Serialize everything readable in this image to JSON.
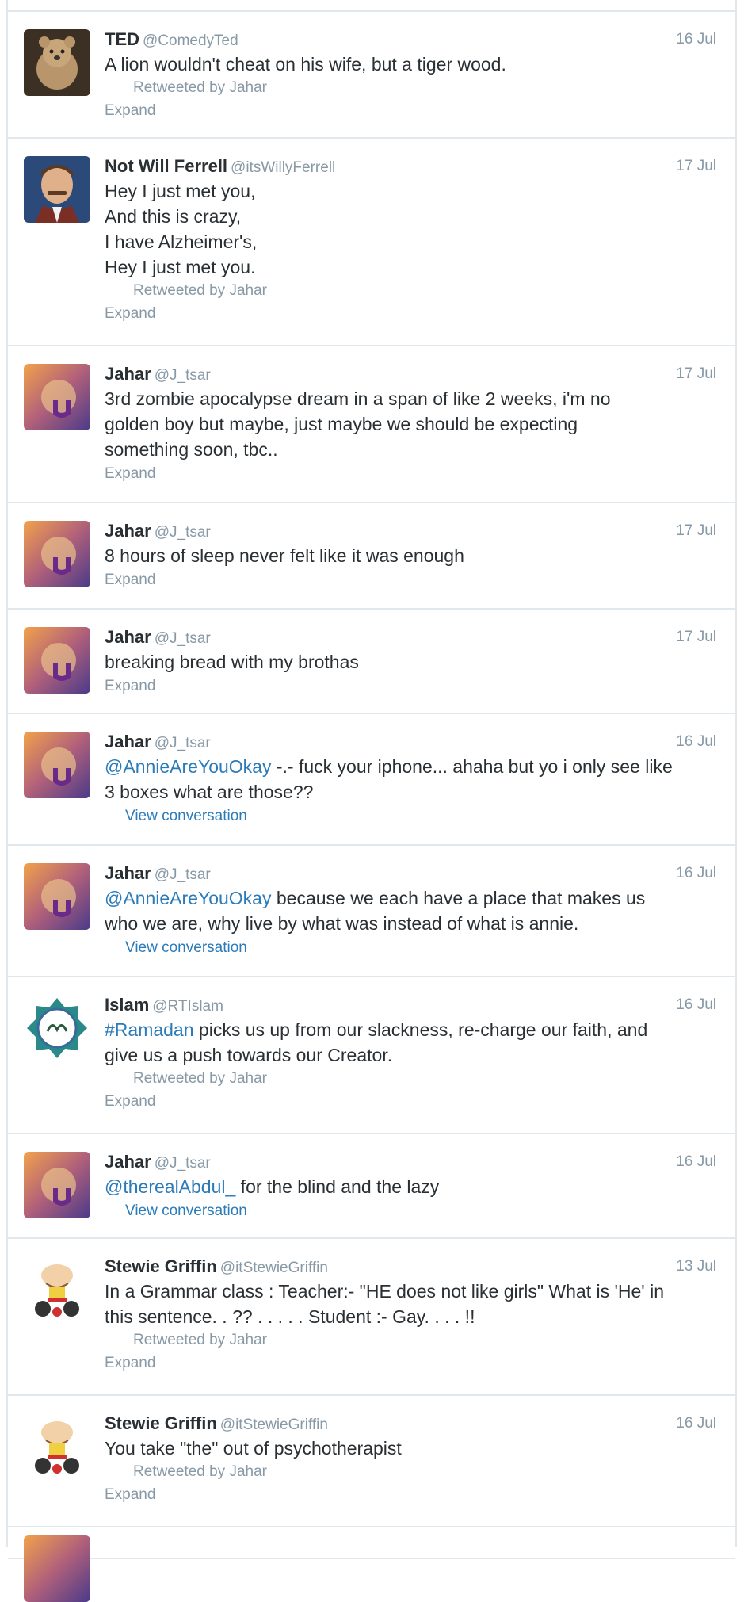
{
  "tweets": [
    {
      "name": "TED",
      "handle": "@ComedyTed",
      "time": "16 Jul",
      "lines": [
        "A lion wouldn't cheat on his wife, but a tiger wood."
      ],
      "retweet": "Retweeted by Jahar",
      "action": "Expand"
    },
    {
      "name": "Not Will Ferrell",
      "handle": "@itsWillyFerrell",
      "time": "17 Jul",
      "lines": [
        "Hey I just met you,",
        "And this is crazy,",
        "I have Alzheimer's,",
        "Hey I just met you."
      ],
      "retweet": "Retweeted by Jahar",
      "action": "Expand"
    },
    {
      "name": "Jahar",
      "handle": "@J_tsar",
      "time": "17 Jul",
      "lines": [
        "3rd zombie apocalypse dream in a span of like 2 weeks, i'm no",
        "golden boy but maybe, just maybe we should be expecting",
        "something soon, tbc.."
      ],
      "action": "Expand"
    },
    {
      "name": "Jahar",
      "handle": "@J_tsar",
      "time": "17 Jul",
      "lines": [
        "8 hours of sleep never felt like it was enough"
      ],
      "action": "Expand"
    },
    {
      "name": "Jahar",
      "handle": "@J_tsar",
      "time": "17 Jul",
      "lines": [
        "breaking bread with my brothas"
      ],
      "action": "Expand"
    },
    {
      "name": "Jahar",
      "handle": "@J_tsar",
      "time": "16 Jul",
      "mention": "@AnnieAreYouOkay",
      "lines": [
        " -.- fuck your iphone... ahaha but yo i only see like",
        "3 boxes what are those??"
      ],
      "action": "View conversation"
    },
    {
      "name": "Jahar",
      "handle": "@J_tsar",
      "time": "16 Jul",
      "mention": "@AnnieAreYouOkay",
      "lines": [
        " because we each have a place that makes us",
        "who we are, why live by what was instead of what is annie."
      ],
      "action": "View conversation"
    },
    {
      "name": "Islam",
      "handle": "@RTIslam",
      "time": "16 Jul",
      "mention": "#Ramadan",
      "lines": [
        " picks us up from our slackness, re-charge our faith, and",
        "give us a push towards our Creator."
      ],
      "retweet": "Retweeted by Jahar",
      "action": "Expand"
    },
    {
      "name": "Jahar",
      "handle": "@J_tsar",
      "time": "16 Jul",
      "mention": "@therealAbdul_",
      "lines": [
        " for the blind and the lazy"
      ],
      "action": "View conversation"
    },
    {
      "name": "Stewie Griffin",
      "handle": "@itStewieGriffin",
      "time": "13 Jul",
      "lines": [
        "In a Grammar class : Teacher:- \"HE does not like girls\" What is 'He' in",
        "this sentence. . ?? . . . . . Student :- Gay. . . . !!"
      ],
      "retweet": "Retweeted by Jahar",
      "action": "Expand"
    },
    {
      "name": "Stewie Griffin",
      "handle": "@itStewieGriffin",
      "time": "16 Jul",
      "lines": [
        "You take \"the\" out of psychotherapist"
      ],
      "retweet": "Retweeted by Jahar",
      "action": "Expand"
    }
  ]
}
